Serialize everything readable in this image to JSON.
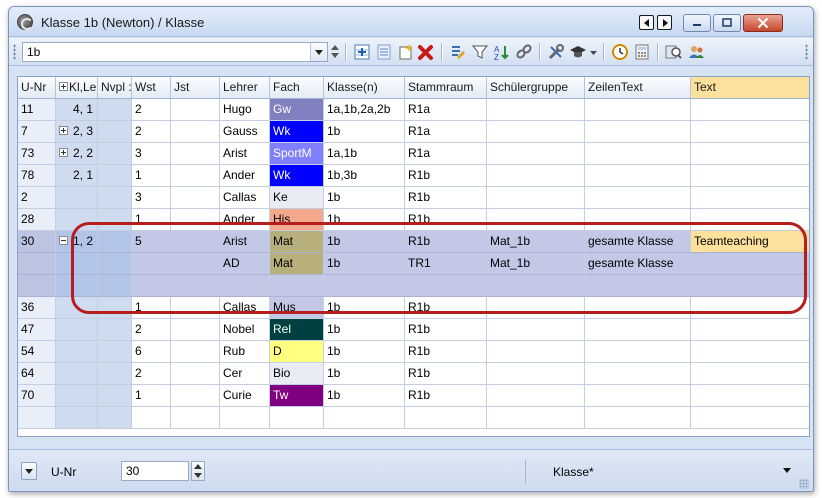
{
  "window": {
    "title": "Klasse 1b (Newton) / Klasse",
    "icon": "gear-clock-icon"
  },
  "toolbar": {
    "filter_value": "1b",
    "icons": [
      "add-row-icon",
      "list-icon",
      "new-item-icon",
      "delete-icon",
      "edit-list-icon",
      "filter-icon",
      "sort-icon",
      "link-icon",
      "tools-icon",
      "graduation-hat-icon",
      "clock-icon",
      "calculator-icon",
      "search-icon",
      "users-icon"
    ]
  },
  "grid": {
    "columns": [
      "U-Nr",
      "Kl,Le",
      "Nvpl :",
      "Wst",
      "Jst",
      "Lehrer",
      "Fach",
      "Klasse(n)",
      "Stammraum",
      "Schülergruppe",
      "ZeilenText",
      "Text"
    ],
    "rows": [
      {
        "unr": "11",
        "kl": "4, 1",
        "kl_expand": false,
        "wst": "2",
        "lehrer": "Hugo",
        "fach": "Gw",
        "fach_bg": "#8080c0",
        "fach_fg": "#ffffff",
        "klassen": "1a,1b,2a,2b",
        "raum": "R1a",
        "gruppe": "",
        "zeilentext": "",
        "text": ""
      },
      {
        "unr": "7",
        "kl": "2, 3",
        "kl_expand": true,
        "wst": "2",
        "lehrer": "Gauss",
        "fach": "Wk",
        "fach_bg": "#0000ff",
        "fach_fg": "#ffffff",
        "klassen": "1b",
        "raum": "R1a",
        "gruppe": "",
        "zeilentext": "",
        "text": ""
      },
      {
        "unr": "73",
        "kl": "2, 2",
        "kl_expand": true,
        "wst": "3",
        "lehrer": "Arist",
        "fach": "SportM",
        "fach_bg": "#8080ff",
        "fach_fg": "#ffffff",
        "klassen": "1a,1b",
        "raum": "R1a",
        "gruppe": "",
        "zeilentext": "",
        "text": ""
      },
      {
        "unr": "78",
        "kl": "2, 1",
        "kl_expand": false,
        "wst": "1",
        "lehrer": "Ander",
        "fach": "Wk",
        "fach_bg": "#0000ff",
        "fach_fg": "#ffffff",
        "klassen": "1b,3b",
        "raum": "R1b",
        "gruppe": "",
        "zeilentext": "",
        "text": ""
      },
      {
        "unr": "2",
        "kl": "",
        "kl_expand": false,
        "wst": "3",
        "lehrer": "Callas",
        "fach": "Ke",
        "fach_bg": "#e8ecf4",
        "fach_fg": "#000000",
        "klassen": "1b",
        "raum": "R1b",
        "gruppe": "",
        "zeilentext": "",
        "text": ""
      },
      {
        "unr": "28",
        "kl": "",
        "kl_expand": false,
        "wst": "1",
        "lehrer": "Ander",
        "fach": "His",
        "fach_bg": "#f4a88c",
        "fach_fg": "#000000",
        "klassen": "1b",
        "raum": "R1b",
        "gruppe": "",
        "zeilentext": "",
        "text": ""
      },
      {
        "unr": "30",
        "kl": "1, 2",
        "kl_expand": true,
        "kl_minus": true,
        "wst": "5",
        "lehrer": "Arist",
        "fach": "Mat",
        "fach_bg": "#b8b07c",
        "fach_fg": "#000000",
        "klassen": "1b",
        "raum": "R1b",
        "gruppe": "Mat_1b",
        "zeilentext": "gesamte Klasse",
        "text": "Teamteaching",
        "selected": true,
        "text_highlight": true
      },
      {
        "unr": "",
        "kl": "",
        "kl_expand": false,
        "wst": "",
        "lehrer": "AD",
        "fach": "Mat",
        "fach_bg": "#b8b07c",
        "fach_fg": "#000000",
        "klassen": "1b",
        "raum": "TR1",
        "gruppe": "Mat_1b",
        "zeilentext": "gesamte Klasse",
        "text": "",
        "selected": true
      },
      {
        "unr": "",
        "kl": "",
        "kl_expand": false,
        "wst": "",
        "lehrer": "",
        "fach": "",
        "fach_bg": "",
        "fach_fg": "",
        "klassen": "",
        "raum": "",
        "gruppe": "",
        "zeilentext": "",
        "text": "",
        "selected": true
      },
      {
        "unr": "36",
        "kl": "",
        "kl_expand": false,
        "wst": "1",
        "lehrer": "Callas",
        "fach": "Mus",
        "fach_bg": "#c2c8e6",
        "fach_fg": "#000000",
        "klassen": "1b",
        "raum": "R1b",
        "gruppe": "",
        "zeilentext": "",
        "text": ""
      },
      {
        "unr": "47",
        "kl": "",
        "kl_expand": false,
        "wst": "2",
        "lehrer": "Nobel",
        "fach": "Rel",
        "fach_bg": "#004040",
        "fach_fg": "#ffffff",
        "klassen": "1b",
        "raum": "R1b",
        "gruppe": "",
        "zeilentext": "",
        "text": ""
      },
      {
        "unr": "54",
        "kl": "",
        "kl_expand": false,
        "wst": "6",
        "lehrer": "Rub",
        "fach": "D",
        "fach_bg": "#ffff80",
        "fach_fg": "#000000",
        "klassen": "1b",
        "raum": "R1b",
        "gruppe": "",
        "zeilentext": "",
        "text": ""
      },
      {
        "unr": "64",
        "kl": "",
        "kl_expand": false,
        "wst": "2",
        "lehrer": "Cer",
        "fach": "Bio",
        "fach_bg": "#e8ecf4",
        "fach_fg": "#000000",
        "klassen": "1b",
        "raum": "R1b",
        "gruppe": "",
        "zeilentext": "",
        "text": ""
      },
      {
        "unr": "70",
        "kl": "",
        "kl_expand": false,
        "wst": "1",
        "lehrer": "Curie",
        "fach": "Tw",
        "fach_bg": "#800080",
        "fach_fg": "#ffffff",
        "klassen": "1b",
        "raum": "R1b",
        "gruppe": "",
        "zeilentext": "",
        "text": ""
      },
      {
        "unr": "",
        "kl": "",
        "kl_expand": false,
        "wst": "",
        "lehrer": "",
        "fach": "",
        "fach_bg": "",
        "fach_fg": "",
        "klassen": "",
        "raum": "",
        "gruppe": "",
        "zeilentext": "",
        "text": ""
      }
    ]
  },
  "statusbar": {
    "field_label": "U-Nr",
    "field_value": "30",
    "view_label": "Klasse*"
  }
}
